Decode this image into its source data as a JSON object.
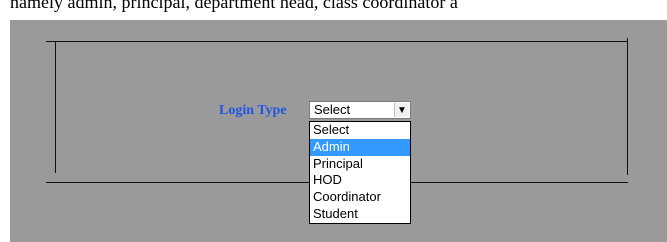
{
  "caption": "namely admin, principal, department head, class coordinator a",
  "login": {
    "label": "Login Type",
    "selected_value": "Select",
    "highlighted_option": "Admin",
    "options": [
      "Select",
      "Admin",
      "Principal",
      "HOD",
      "Coordinator",
      "Student"
    ]
  },
  "colors": {
    "background": "#9a9a9a",
    "label": "#2255e6",
    "highlight": "#3399ff"
  },
  "icons": {
    "dropdown_arrow": "chevron-down-icon"
  }
}
